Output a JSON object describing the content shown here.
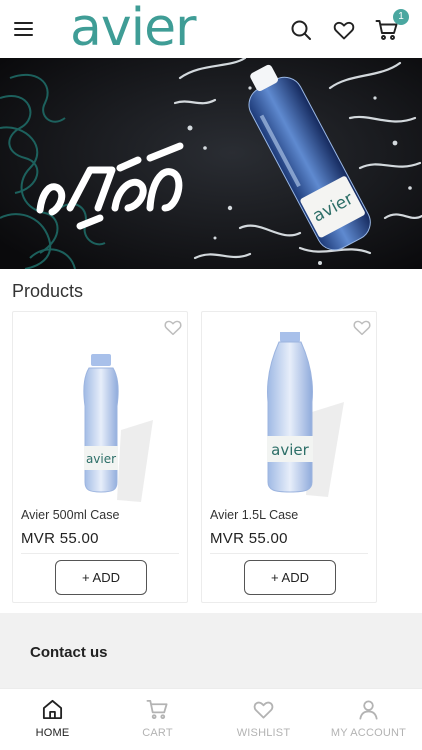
{
  "header": {
    "logo_text": "avier",
    "cart_count": "1",
    "icons": [
      "hamburger-menu-icon",
      "search-icon",
      "heart-icon",
      "cart-icon"
    ]
  },
  "banner": {
    "bottle_label": "avier"
  },
  "products_section": {
    "title": "Products",
    "items": [
      {
        "name": "Avier 500ml Case",
        "price": "MVR  55.00",
        "add_label": "+ ADD",
        "label_text": "avier"
      },
      {
        "name": "Avier 1.5L Case",
        "price": "MVR  55.00",
        "add_label": "+ ADD",
        "label_text": "avier"
      }
    ]
  },
  "contact": {
    "title": "Contact us"
  },
  "bottom_nav": {
    "items": [
      {
        "label": "HOME",
        "icon": "home-icon",
        "active": true
      },
      {
        "label": "CART",
        "icon": "cart-icon",
        "active": false
      },
      {
        "label": "WISHLIST",
        "icon": "heart-icon",
        "active": false
      },
      {
        "label": "MY ACCOUNT",
        "icon": "user-icon",
        "active": false
      }
    ]
  },
  "colors": {
    "brand": "#3f9d96",
    "badge": "#4aa7a0",
    "nav_active": "#222222",
    "nav_inactive": "#b3b3b3"
  }
}
